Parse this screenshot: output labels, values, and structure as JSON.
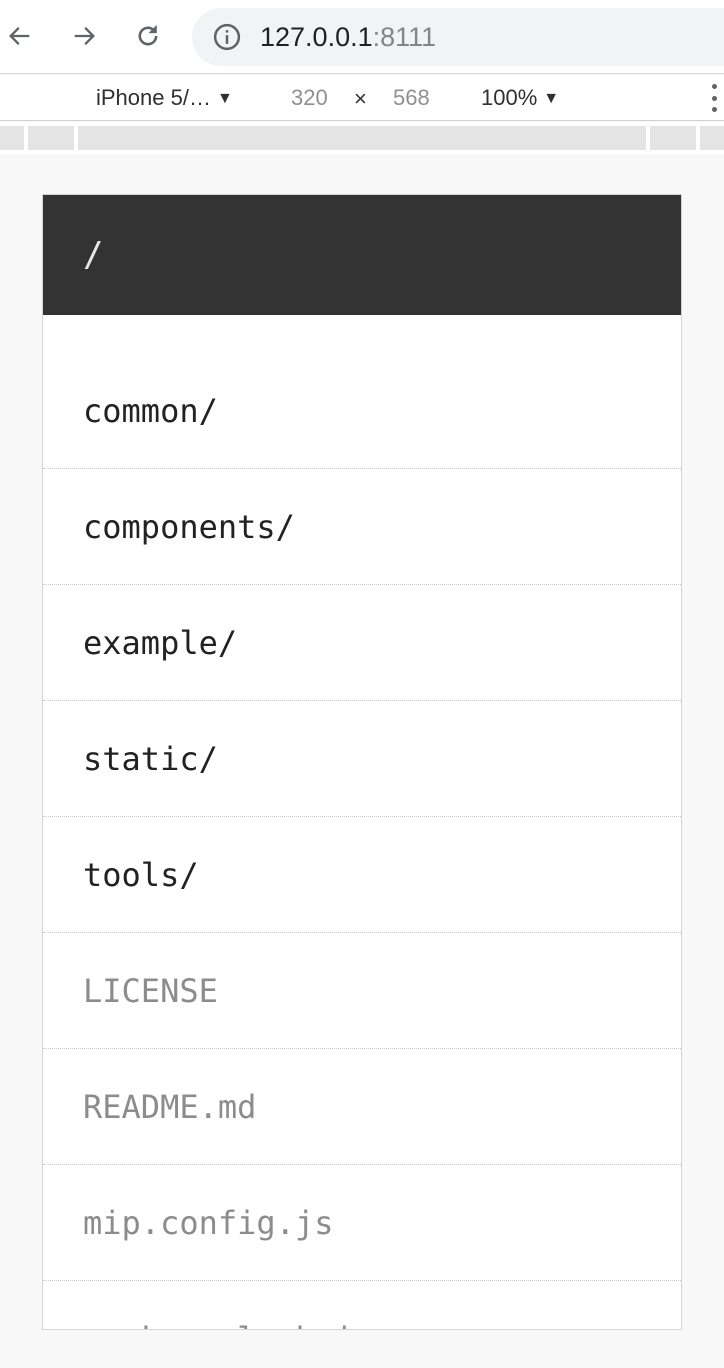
{
  "browser": {
    "url_host": "127.0.0.1",
    "url_port": ":8111"
  },
  "device_toolbar": {
    "device": "iPhone 5/…",
    "width": "320",
    "times": "×",
    "height": "568",
    "zoom": "100%"
  },
  "page": {
    "title": "/",
    "entries": [
      {
        "name": "common/",
        "kind": "dir"
      },
      {
        "name": "components/",
        "kind": "dir"
      },
      {
        "name": "example/",
        "kind": "dir"
      },
      {
        "name": "static/",
        "kind": "dir"
      },
      {
        "name": "tools/",
        "kind": "dir"
      },
      {
        "name": "LICENSE",
        "kind": "file"
      },
      {
        "name": "README.md",
        "kind": "file"
      },
      {
        "name": "mip.config.js",
        "kind": "file"
      },
      {
        "name": "package-lock.json",
        "kind": "file"
      }
    ]
  },
  "colors": {
    "header_bg": "#333333",
    "dir_text": "#222222",
    "file_text": "#8c8c8c"
  }
}
